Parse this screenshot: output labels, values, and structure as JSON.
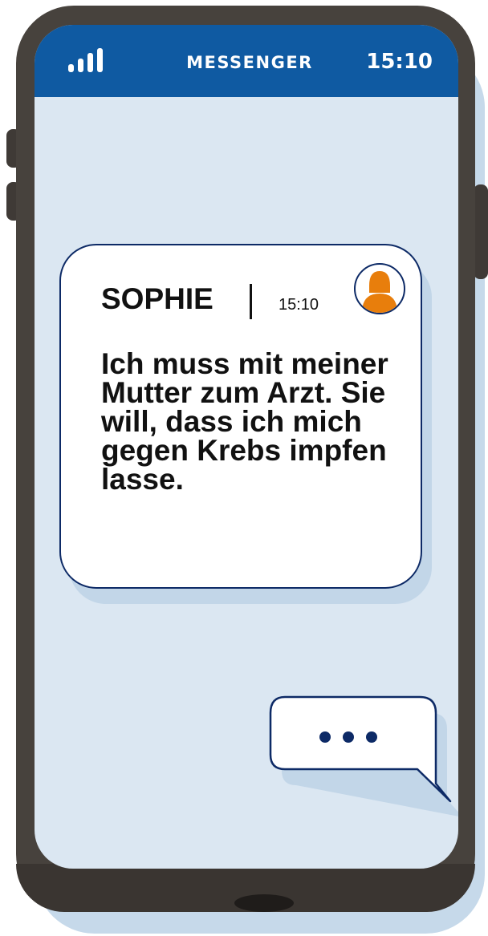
{
  "status_bar": {
    "signal_icon": "signal-bars-icon",
    "app_title": "MESSENGER",
    "time": "15:10"
  },
  "message": {
    "sender": "SOPHIE",
    "time": "15:10",
    "avatar_icon": "person-avatar-icon",
    "text": "Ich muss mit meiner Mutter zum Arzt. Sie will, dass ich mich gegen Krebs impfen lasse."
  },
  "typing_indicator": {
    "icon": "typing-dots-icon"
  },
  "colors": {
    "header": "#0f5aa2",
    "screen": "#dbe7f2",
    "phone_body": "#47423d",
    "bubble_border": "#0d2a66",
    "avatar": "#e87e0c",
    "dots": "#0d2a66"
  }
}
